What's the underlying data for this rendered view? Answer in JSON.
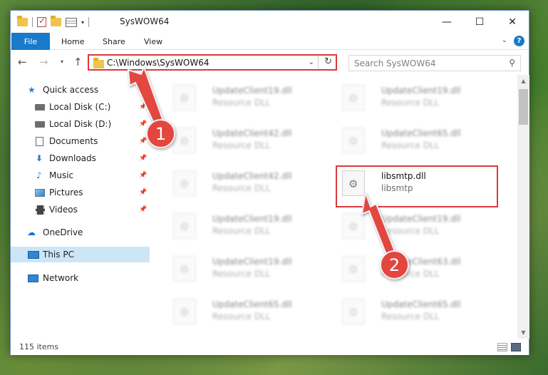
{
  "window": {
    "title": "SysWOW64"
  },
  "window_controls": {
    "minimize": "—",
    "maximize": "☐",
    "close": "✕"
  },
  "ribbon": {
    "file_tab": "File",
    "tabs": [
      "Home",
      "Share",
      "View"
    ],
    "help": "?"
  },
  "nav": {
    "back": "←",
    "forward": "→",
    "dropdown": "▾",
    "up": "↑"
  },
  "address": {
    "path": "C:\\Windows\\SysWOW64"
  },
  "search": {
    "placeholder": "Search SysWOW64"
  },
  "sidebar": {
    "items": [
      {
        "label": "Quick access",
        "icon": "star-icon"
      },
      {
        "label": "Local Disk (C:)",
        "icon": "drive-icon",
        "pinned": true
      },
      {
        "label": "Local Disk (D:)",
        "icon": "drive-icon",
        "pinned": true
      },
      {
        "label": "Documents",
        "icon": "documents-icon",
        "pinned": true
      },
      {
        "label": "Downloads",
        "icon": "downloads-icon",
        "pinned": true
      },
      {
        "label": "Music",
        "icon": "music-icon",
        "pinned": true
      },
      {
        "label": "Pictures",
        "icon": "pictures-icon",
        "pinned": true
      },
      {
        "label": "Videos",
        "icon": "videos-icon",
        "pinned": true
      },
      {
        "label": "OneDrive",
        "icon": "onedrive-icon"
      },
      {
        "label": "This PC",
        "icon": "this-pc-icon",
        "selected": true
      },
      {
        "label": "Network",
        "icon": "network-icon"
      }
    ]
  },
  "files": [
    {
      "name": "UpdateClient19.dll",
      "description": "Resource DLL"
    },
    {
      "name": "UpdateClient19.dll",
      "description": "Resource DLL"
    },
    {
      "name": "UpdateClient42.dll",
      "description": "Resource DLL"
    },
    {
      "name": "UpdateClient65.dll",
      "description": "Resource DLL"
    },
    {
      "name": "UpdateClient42.dll",
      "description": "Resource DLL"
    },
    {
      "name": "libsmtp.dll",
      "description": "libsmtp",
      "highlighted": true
    },
    {
      "name": "UpdateClient19.dll",
      "description": "Resource DLL"
    },
    {
      "name": "UpdateClient19.dll",
      "description": "Resource DLL"
    },
    {
      "name": "UpdateClient19.dll",
      "description": "Resource DLL"
    },
    {
      "name": "UpdateClient63.dll",
      "description": "Resource DLL"
    },
    {
      "name": "UpdateClient65.dll",
      "description": "Resource DLL"
    },
    {
      "name": "UpdateClient65.dll",
      "description": "Resource DLL"
    }
  ],
  "status": {
    "item_count": "115 items"
  },
  "annotations": [
    {
      "number": "1",
      "color": "#e2463f"
    },
    {
      "number": "2",
      "color": "#e2463f"
    }
  ],
  "colors": {
    "accent": "#1979ca",
    "highlight_box": "#d9393d",
    "selected_nav": "#cce6f7"
  }
}
